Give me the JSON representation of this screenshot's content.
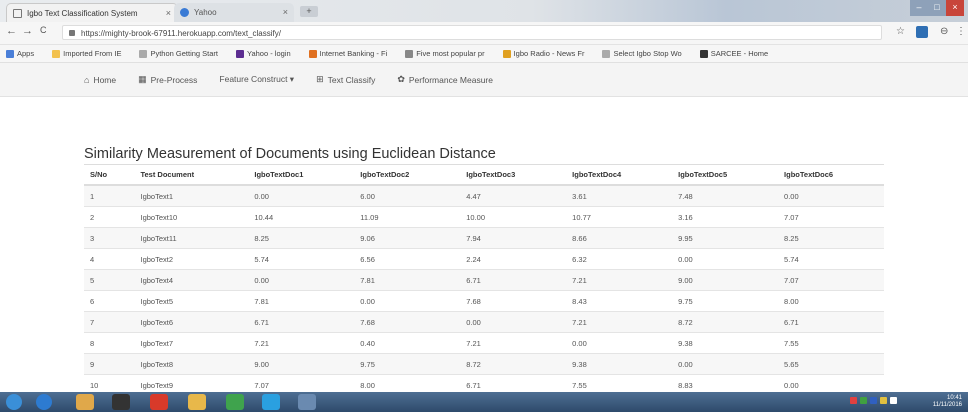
{
  "browser": {
    "tabs": [
      {
        "title": "Igbo Text Classification System",
        "close": "×"
      },
      {
        "title": "Yahoo",
        "close": "×"
      }
    ],
    "new_tab": "+",
    "address": "https://mighty-brook-67911.herokuapp.com/text_classify/",
    "nav": {
      "back": "←",
      "forward": "→",
      "reload": "C"
    },
    "star": "☆",
    "profile": "⊖",
    "menu": "⋮",
    "bookmarks": [
      {
        "label": "Apps",
        "color": "#4a7fd8"
      },
      {
        "label": "Imported From IE",
        "color": "#f2c14e"
      },
      {
        "label": "Python Getting Start",
        "color": "#aaaaaa"
      },
      {
        "label": "Yahoo - login",
        "color": "#5c2d91"
      },
      {
        "label": "Internet Banking - Fi",
        "color": "#e07020"
      },
      {
        "label": "Five most popular pr",
        "color": "#888888"
      },
      {
        "label": "Igbo Radio - News Fr",
        "color": "#e0a020"
      },
      {
        "label": "Select Igbo Stop Wo",
        "color": "#aaaaaa"
      },
      {
        "label": "SARCEE - Home",
        "color": "#333333"
      }
    ],
    "window_controls": [
      "–",
      "□",
      "×"
    ]
  },
  "appnav": {
    "items": [
      {
        "label": "Home",
        "icon": "home-icon",
        "glyph": "⌂"
      },
      {
        "label": "Pre-Process",
        "icon": "grid-icon",
        "glyph": "▦"
      },
      {
        "label": "Feature Construct ▾",
        "icon": "",
        "glyph": ""
      },
      {
        "label": "Text Classify",
        "icon": "text-classify-icon",
        "glyph": "⊞"
      },
      {
        "label": "Performance Measure",
        "icon": "gear-icon",
        "glyph": "✿"
      }
    ]
  },
  "page": {
    "title": "Similarity Measurement of Documents using Euclidean Distance"
  },
  "table": {
    "headers": [
      "S/No",
      "Test Document",
      "IgboTextDoc1",
      "IgboTextDoc2",
      "IgboTextDoc3",
      "IgboTextDoc4",
      "IgboTextDoc5",
      "IgboTextDoc6"
    ],
    "rows": [
      [
        "1",
        "IgboText1",
        "0.00",
        "6.00",
        "4.47",
        "3.61",
        "7.48",
        "0.00"
      ],
      [
        "2",
        "IgboText10",
        "10.44",
        "11.09",
        "10.00",
        "10.77",
        "3.16",
        "7.07"
      ],
      [
        "3",
        "IgboText11",
        "8.25",
        "9.06",
        "7.94",
        "8.66",
        "9.95",
        "8.25"
      ],
      [
        "4",
        "IgboText2",
        "5.74",
        "6.56",
        "2.24",
        "6.32",
        "0.00",
        "5.74"
      ],
      [
        "5",
        "IgboText4",
        "0.00",
        "7.81",
        "6.71",
        "7.21",
        "9.00",
        "7.07"
      ],
      [
        "6",
        "IgboText5",
        "7.81",
        "0.00",
        "7.68",
        "8.43",
        "9.75",
        "8.00"
      ],
      [
        "7",
        "IgboText6",
        "6.71",
        "7.68",
        "0.00",
        "7.21",
        "8.72",
        "6.71"
      ],
      [
        "8",
        "IgboText7",
        "7.21",
        "0.40",
        "7.21",
        "0.00",
        "9.38",
        "7.55"
      ],
      [
        "9",
        "IgboText8",
        "9.00",
        "9.75",
        "8.72",
        "9.38",
        "0.00",
        "5.65"
      ],
      [
        "10",
        "IgboText9",
        "7.07",
        "8.00",
        "6.71",
        "7.55",
        "8.83",
        "0.00"
      ]
    ]
  },
  "taskbar": {
    "icons": [
      {
        "name": "start-icon",
        "color": "#3a8fd8"
      },
      {
        "name": "ie-icon",
        "color": "#2d7bd1"
      },
      {
        "name": "explorer-icon",
        "color": "#e0a84a"
      },
      {
        "name": "media-icon",
        "color": "#333333"
      },
      {
        "name": "opera-icon",
        "color": "#d83a2a"
      },
      {
        "name": "folder-icon",
        "color": "#e8b84a"
      },
      {
        "name": "chrome-icon",
        "color": "#3fa34d"
      },
      {
        "name": "skype-icon",
        "color": "#2aa0e0"
      },
      {
        "name": "app-icon",
        "color": "#6a8ab0"
      }
    ],
    "tray_icons": [
      "#e04040",
      "#40a040",
      "#3060c0",
      "#e0c040",
      "#ffffff"
    ],
    "time": "10:41",
    "date": "11/11/2016"
  }
}
